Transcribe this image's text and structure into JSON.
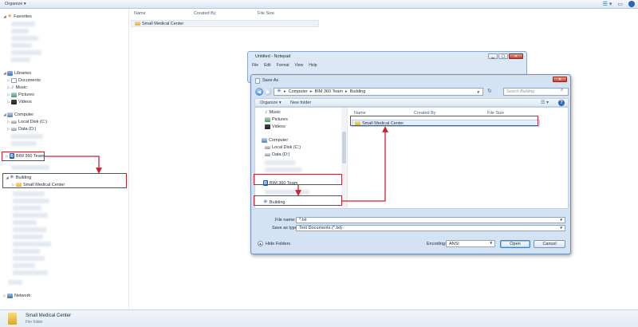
{
  "explorer": {
    "toolbar": {
      "organize": "Organize ▾",
      "view_icon": "☰ ▾",
      "pane_icon": "▭",
      "help": "?"
    },
    "nav": {
      "favorites": "Favorites",
      "libraries": "Libraries",
      "documents": "Documents",
      "music": "Music",
      "pictures": "Pictures",
      "videos": "Videos",
      "computer": "Computer",
      "local_disk": "Local Disk (C:)",
      "data_disk": "Data (D:)",
      "bim_team": "BIM 360 Team",
      "building": "Building",
      "small_medical": "Small Medical Center",
      "network": "Network"
    },
    "content": {
      "columns": [
        "Name",
        "Created By",
        "File Size"
      ],
      "rows": [
        {
          "name": "Small Medical Center"
        }
      ]
    },
    "status": {
      "name": "Small Medical Center",
      "type": "File folder"
    }
  },
  "notepad": {
    "title": "Untitled - Notepad",
    "menu": [
      "File",
      "Edit",
      "Format",
      "View",
      "Help"
    ]
  },
  "saveas": {
    "title": "Save As",
    "address": [
      "Computer",
      "BIM 360 Team",
      "Building"
    ],
    "search_placeholder": "Search Building",
    "organize": "Organize ▾",
    "new_folder": "New folder",
    "left_items": {
      "music": "Music",
      "pictures": "Pictures",
      "videos": "Videos",
      "computer": "Computer",
      "local_disk": "Local Disk (C:)",
      "data_disk": "Data (D:)",
      "bim_team": "BIM 360 Team",
      "building": "Building"
    },
    "columns": [
      "Name",
      "Created By",
      "File Size"
    ],
    "files": [
      {
        "name": "Small Medical Center"
      }
    ],
    "file_name_label": "File name:",
    "file_name_value": "*.txt",
    "save_type_label": "Save as type:",
    "save_type_value": "Text Documents (*.txt)",
    "encoding_label": "Encoding:",
    "encoding_value": "ANSI",
    "open": "Open",
    "cancel": "Cancel",
    "hide_folders": "Hide Folders"
  },
  "colors": {
    "highlight": "#c8242f",
    "accent": "#2a68b8"
  }
}
